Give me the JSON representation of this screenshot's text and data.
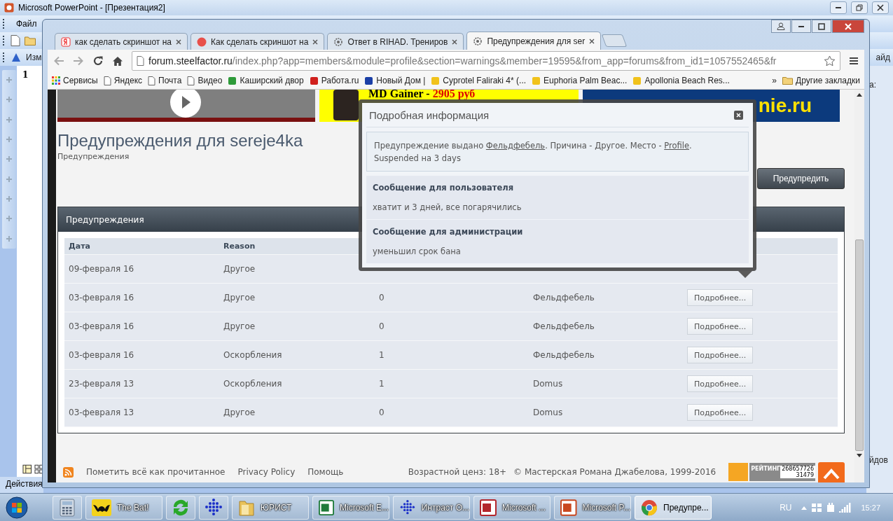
{
  "powerpoint": {
    "title": "Microsoft PowerPoint - [Презентация2]",
    "menu": [
      "Файл"
    ],
    "toolbar_fragment": "Изм",
    "slide_number": "1",
    "right_fragments": [
      "айд",
      "а:",
      "йдов"
    ],
    "task_pane": "Действия"
  },
  "browser": {
    "tabs": [
      {
        "title": "как сделать скриншот на",
        "kind": "yandex",
        "selected": false
      },
      {
        "title": "Как сделать скриншот на",
        "kind": "record",
        "selected": false
      },
      {
        "title": "Ответ в RIHAD. Трениров",
        "kind": "gear",
        "selected": false
      },
      {
        "title": "Предупреждения для ser",
        "kind": "gear",
        "selected": true
      }
    ],
    "address": {
      "host": "forum.steelfactor.ru",
      "path": "/index.php?app=members&module=profile&section=warnings&member=19595&from_app=forums&from_id1=1057552465&fr"
    },
    "bookmarks": [
      {
        "label": "Сервисы",
        "kind": "apps"
      },
      {
        "label": "Яндекс",
        "kind": "page"
      },
      {
        "label": "Почта",
        "kind": "page"
      },
      {
        "label": "Видео",
        "kind": "page"
      },
      {
        "label": "Каширский двор",
        "kind": "green"
      },
      {
        "label": "Работа.ru",
        "kind": "red"
      },
      {
        "label": "Новый Дом |",
        "kind": "blue"
      },
      {
        "label": "Cyprotel Faliraki 4* (...",
        "kind": "yellow"
      },
      {
        "label": "Euphoria Palm Beac...",
        "kind": "yellow"
      },
      {
        "label": "Apollonia Beach Res...",
        "kind": "yellow"
      }
    ],
    "overflow": "»",
    "other": "Другие закладки"
  },
  "page": {
    "ads": {
      "product": "MD Gainer - ",
      "price": "2905 руб",
      "banner": "nie.ru"
    },
    "title": "Предупреждения для sereje4ka",
    "breadcrumb": "Предупреждения",
    "warn_button": "Предупредить",
    "panel_title": "Предупреждения",
    "table": {
      "columns": [
        "Дата",
        "Reason"
      ],
      "rows": [
        {
          "date": "09-февраля 16",
          "reason": "Другое"
        },
        {
          "date": "03-февраля 16",
          "reason": "Другое",
          "points": "0",
          "issued_by": "Фельдфебель",
          "action": "Подробнее..."
        },
        {
          "date": "03-февраля 16",
          "reason": "Другое",
          "points": "0",
          "issued_by": "Фельдфебель",
          "action": "Подробнее..."
        },
        {
          "date": "03-февраля 16",
          "reason": "Оскорбления",
          "points": "1",
          "issued_by": "Фельдфебель",
          "action": "Подробнее..."
        },
        {
          "date": "23-февраля 13",
          "reason": "Оскорбления",
          "points": "1",
          "issued_by": "Domus",
          "action": "Подробнее..."
        },
        {
          "date": "03-февраля 13",
          "reason": "Другое",
          "points": "0",
          "issued_by": "Domus",
          "action": "Подробнее..."
        }
      ]
    },
    "footer": {
      "links": [
        "Пометить всё как прочитанное",
        "Privacy Policy",
        "Помощь"
      ],
      "age": "Возрастной ценз: 18+",
      "copyright": "© Мастерская Романа Джабелова, 1999-2016",
      "counter": {
        "label": "РЕЙТИНГ",
        "hits": "268657726",
        "hosts": "31479"
      }
    },
    "popup": {
      "title": "Подробная информация",
      "info": [
        {
          "text": "Предупреждение выдано ",
          "kind": "text"
        },
        {
          "text": "Фельдфебель",
          "kind": "link"
        },
        {
          "text": ". Причина - Другое. Место - ",
          "kind": "text"
        },
        {
          "text": "Profile",
          "kind": "link"
        },
        {
          "text": ".",
          "kind": "text"
        }
      ],
      "info_2": "Suspended на 3 days",
      "sections": [
        {
          "title": "Сообщение для пользователя",
          "text": "хватит и 3 дней, все погарячились"
        },
        {
          "title": "Сообщение для администрации",
          "text": "уменьшил срок бана"
        }
      ]
    }
  },
  "taskbar": {
    "items": [
      {
        "kind": "calc",
        "selected": false
      },
      {
        "label": "The Bat!",
        "kind": "bat",
        "selected": false
      },
      {
        "kind": "refresh",
        "selected": false
      },
      {
        "kind": "dots",
        "selected": false
      },
      {
        "label": "ЮРИСТ",
        "kind": "folder",
        "selected": false
      },
      {
        "label": "Microsoft E...",
        "kind": "excel",
        "selected": false
      },
      {
        "label": "Интраст О...",
        "kind": "dots",
        "selected": false
      },
      {
        "label": "Microsoft ...",
        "kind": "access",
        "selected": false
      },
      {
        "label": "Microsoft P...",
        "kind": "ppt",
        "selected": false
      },
      {
        "label": "Предупре...",
        "kind": "chrome",
        "selected": true
      }
    ],
    "language": "RU",
    "time": "15:27"
  }
}
